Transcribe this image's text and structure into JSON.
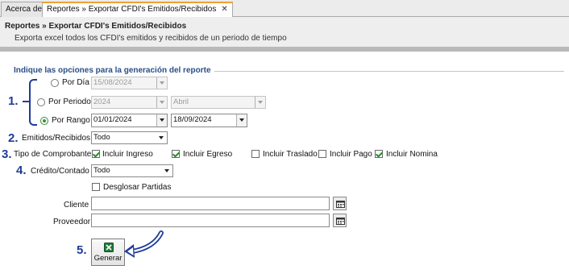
{
  "tabs": [
    {
      "label": "Acerca de"
    },
    {
      "label": "Reportes » Exportar CFDI's Emitidos/Recibidos",
      "close": "✕"
    }
  ],
  "header": {
    "title": "Reportes » Exportar CFDI's Emitidos/Recibidos",
    "subtitle": "Exporta excel todos los CFDI's emitidos y recibidos de un periodo de tiempo"
  },
  "group_title": "Indique las opciones para la generación del reporte",
  "annotations": {
    "n1": "1.",
    "n2": "2.",
    "n3": "3.",
    "n4": "4.",
    "n5": "5."
  },
  "por_dia": {
    "label": "Por Día",
    "date": "15/08/2024",
    "selected": false
  },
  "por_periodo": {
    "label": "Por Periodo",
    "year": "2024",
    "month": "Abril",
    "selected": false
  },
  "por_rango": {
    "label": "Por Rango",
    "from": "01/01/2024",
    "to": "18/09/2024",
    "selected": true
  },
  "emitidos": {
    "label": "Emitidos/Recibidos",
    "value": "Todo"
  },
  "tipo": {
    "label": "Tipo de Comprobante",
    "options": [
      {
        "label": "Incluir Ingreso",
        "checked": true
      },
      {
        "label": "Incluir Egreso",
        "checked": true
      },
      {
        "label": "Incluir Traslado",
        "checked": false
      },
      {
        "label": "Incluir Pago",
        "checked": false
      },
      {
        "label": "Incluir Nomina",
        "checked": true
      }
    ]
  },
  "credito": {
    "label": "Crédito/Contado",
    "value": "Todo"
  },
  "desglosar": {
    "label": "Desglosar Partidas",
    "checked": false
  },
  "cliente": {
    "label": "Cliente",
    "value": ""
  },
  "proveedor": {
    "label": "Proveedor",
    "value": ""
  },
  "generar": {
    "label": "Generar"
  },
  "colors": {
    "accent": "#1e3c9a",
    "group_title": "#2a4f87",
    "check": "#2e8a2e"
  }
}
